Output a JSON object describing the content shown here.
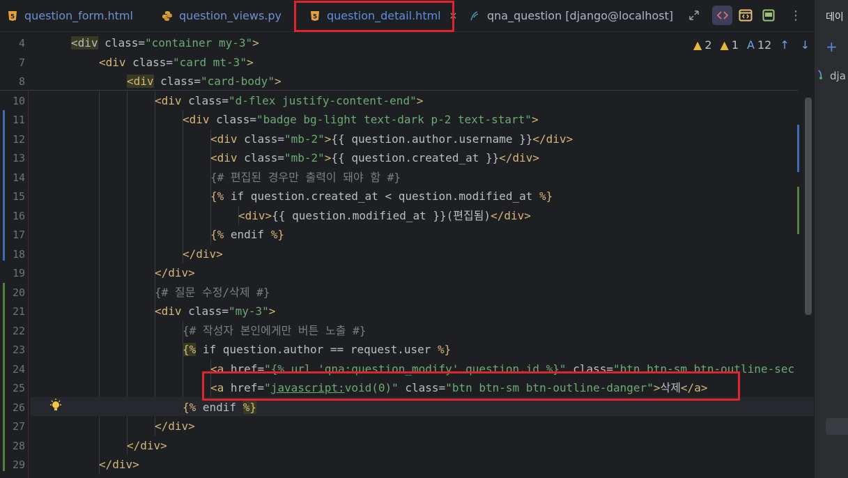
{
  "tabs": [
    {
      "label": "question_form.html",
      "icon": "html5-icon"
    },
    {
      "label": "question_views.py",
      "icon": "python-icon"
    },
    {
      "label": "question_detail.html",
      "icon": "html5-icon",
      "active": true,
      "close": "×"
    },
    {
      "label": "qna_question [django@localhost]",
      "icon": "database-table-icon"
    }
  ],
  "inspection": {
    "warn_a": "2",
    "warn_b": "1",
    "typo": "12"
  },
  "right_panel": {
    "title": "데이",
    "item": "dja",
    "add": "+"
  },
  "lines": [
    {
      "num": "4",
      "html": "<span class='hl-tag'>&lt;div</span> <span class='attr'>class</span>=<span class='str'>\"container my-3\"</span><span class='tag'>&gt;</span>"
    },
    {
      "num": "7",
      "html": "<span class='tag'>&lt;div</span> <span class='attr'>class</span>=<span class='str'>\"card mt-3\"</span><span class='tag'>&gt;</span>"
    },
    {
      "num": "8",
      "html": "<span class='hl-tag tag'>&lt;div</span> <span class='attr'>class</span>=<span class='str'>\"card-body\"</span><span class='tag'>&gt;</span>"
    },
    {
      "num": "10",
      "html": "<span class='tag'>&lt;div</span> <span class='attr'>class</span>=<span class='str'>\"d-flex justify-content-end\"</span><span class='tag'>&gt;</span>"
    },
    {
      "num": "11",
      "html": "<span class='tag'>&lt;div</span> <span class='attr'>class</span>=<span class='str'>\"badge bg-light text-dark p-2 text-start\"</span><span class='tag'>&gt;</span>"
    },
    {
      "num": "12",
      "html": "<span class='tag'>&lt;div</span> <span class='attr'>class</span>=<span class='str'>\"mb-2\"</span><span class='tag'>&gt;</span><span class='txt'>{{ question.author.username }}</span><span class='tag'>&lt;/div&gt;</span>"
    },
    {
      "num": "13",
      "html": "<span class='tag'>&lt;div</span> <span class='attr'>class</span>=<span class='str'>\"mb-2\"</span><span class='tag'>&gt;</span><span class='txt'>{{ question.created_at }}</span><span class='tag'>&lt;/div&gt;</span>"
    },
    {
      "num": "14",
      "html": "<span class='cm'>{# 편집된 경우만 출력이 돼야 함 #}</span>"
    },
    {
      "num": "15",
      "html": "<span class='tpl'>{%</span><span class='txt'> if question.created_at &lt; question.modified_at </span><span class='tpl'>%}</span>"
    },
    {
      "num": "16",
      "html": "<span class='tag'>&lt;div&gt;</span><span class='txt'>{{ question.modified_at }}(편집됨)</span><span class='tag'>&lt;/div&gt;</span>"
    },
    {
      "num": "17",
      "html": "<span class='tpl'>{%</span><span class='txt'> endif </span><span class='tpl'>%}</span>"
    },
    {
      "num": "18",
      "html": "<span class='tag'>&lt;/div&gt;</span>"
    },
    {
      "num": "19",
      "html": "<span class='tag'>&lt;/div&gt;</span>"
    },
    {
      "num": "20",
      "html": "<span class='cm'>{# 질문 수정/삭제 #}</span>"
    },
    {
      "num": "21",
      "html": "<span class='tag'>&lt;div</span> <span class='attr'>class</span>=<span class='str'>\"my-3\"</span><span class='tag'>&gt;</span>"
    },
    {
      "num": "22",
      "html": "<span class='cm'>{# 작성자 본인에게만 버튼 노출 #}</span>"
    },
    {
      "num": "23",
      "html": "<span class='tpl hl-tag'>{%</span><span class='txt'> if question.author == request.user </span><span class='tpl'>%}</span>"
    },
    {
      "num": "24",
      "html": "<span class='tag'>&lt;a</span> <span class='attr'>href</span>=<span class='str'>\"{% url 'qna:question_modify' question.id %}\"</span> <span class='attr'>class</span>=<span class='str'>\"btn btn-sm btn-outline-sec</span>"
    },
    {
      "num": "25",
      "html": "<span class='tag'>&lt;a</span> <span class='attr'>href</span>=<span class='str'>\"<u>javascript:</u>void(0)\"</span> <span class='attr'>class</span>=<span class='str'>\"btn btn-sm btn-outline-danger\"</span><span class='tag'>&gt;</span><span class='txt'>삭제</span><span class='tag'>&lt;/a&gt;</span>"
    },
    {
      "num": "26",
      "html": "<span class='tpl'>{%</span><span class='txt'> endif </span><span class='tpl hl-tag'>%}</span>"
    },
    {
      "num": "27",
      "html": "<span class='tag'>&lt;/div&gt;</span>"
    },
    {
      "num": "28",
      "html": "<span class='tag'>&lt;/div&gt;</span>"
    },
    {
      "num": "29",
      "html": "<span class='tag'>&lt;/div&gt;</span>"
    }
  ]
}
